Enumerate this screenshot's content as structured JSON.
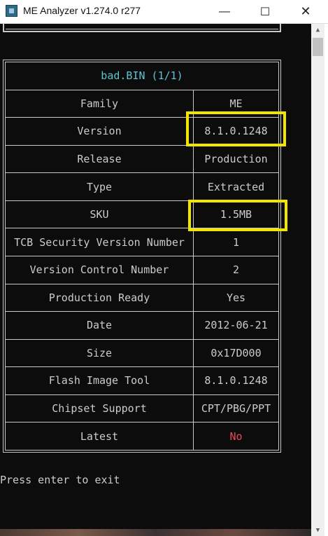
{
  "window": {
    "title": "ME Analyzer v1.274.0 r277",
    "minimize_glyph": "—",
    "maximize_glyph": "☐",
    "close_glyph": "✕"
  },
  "table": {
    "header": "bad.BIN (1/1)",
    "rows": [
      {
        "label": "Family",
        "value": "ME"
      },
      {
        "label": "Version",
        "value": "8.1.0.1248"
      },
      {
        "label": "Release",
        "value": "Production"
      },
      {
        "label": "Type",
        "value": "Extracted"
      },
      {
        "label": "SKU",
        "value": "1.5MB"
      },
      {
        "label": "TCB Security Version Number",
        "value": "1"
      },
      {
        "label": "Version Control Number",
        "value": "2"
      },
      {
        "label": "Production Ready",
        "value": "Yes"
      },
      {
        "label": "Date",
        "value": "2012-06-21"
      },
      {
        "label": "Size",
        "value": "0x17D000"
      },
      {
        "label": "Flash Image Tool",
        "value": "8.1.0.1248"
      },
      {
        "label": "Chipset Support",
        "value": "CPT/PBG/PPT"
      },
      {
        "label": "Latest",
        "value": "No"
      }
    ]
  },
  "prompt": "Press enter to exit",
  "colors": {
    "header_text": "#5fc3d0",
    "warning_text": "#e74856",
    "highlight_box": "#f2e600"
  }
}
